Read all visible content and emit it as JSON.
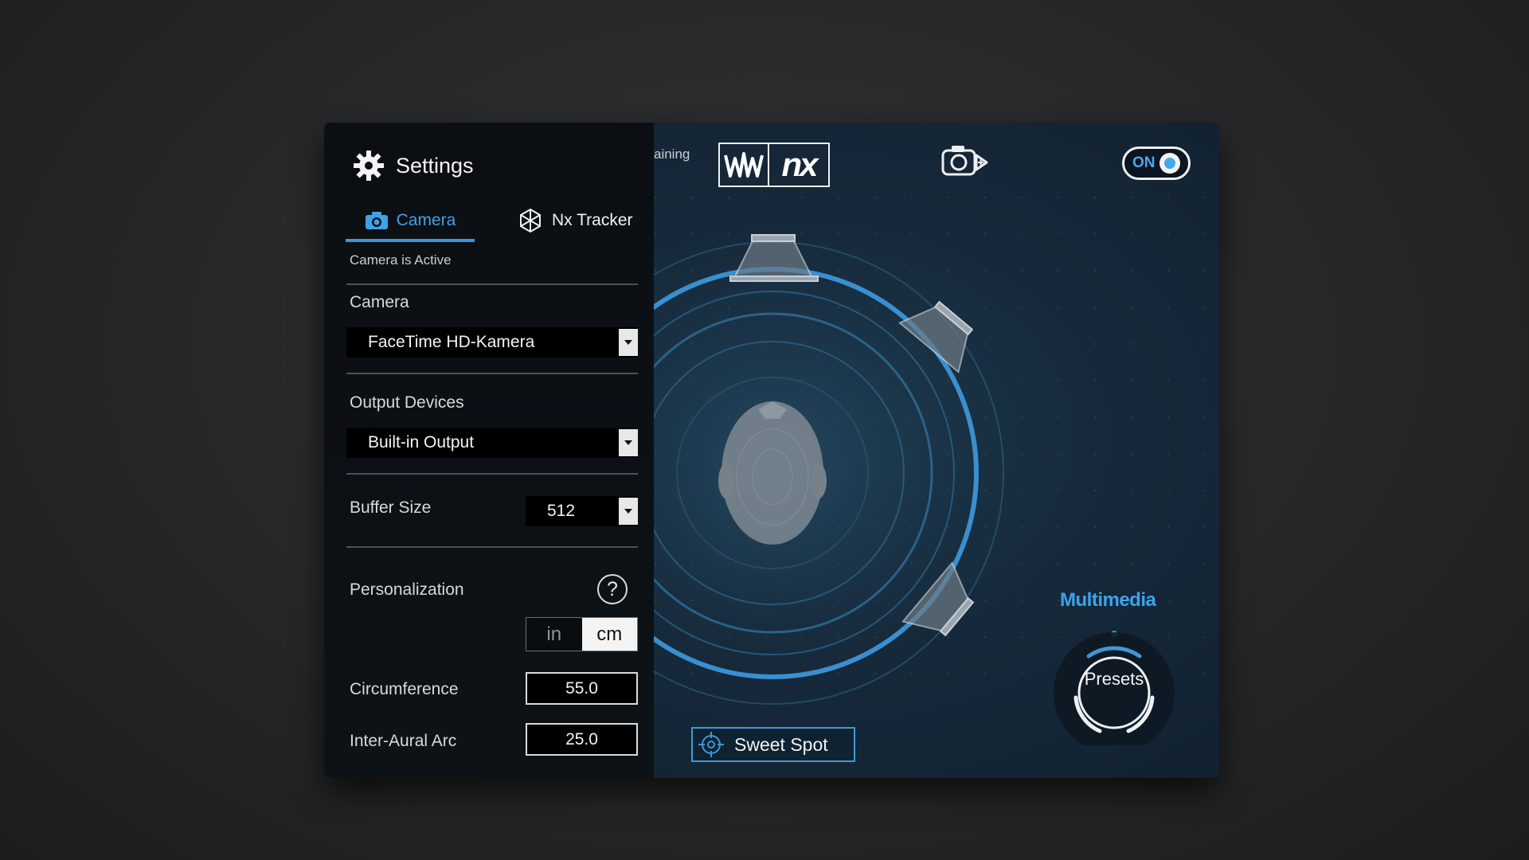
{
  "panel": {
    "title": "Settings",
    "title_icon": "gear-icon",
    "tabs": [
      {
        "label": "Camera",
        "icon": "camera-icon",
        "active": true
      },
      {
        "label": "Nx Tracker",
        "icon": "nx-tracker-icon",
        "active": false
      }
    ],
    "status": "Camera is Active",
    "camera": {
      "label": "Camera",
      "value": "FaceTime HD-Kamera"
    },
    "output": {
      "label": "Output Devices",
      "value": "Built-in Output"
    },
    "buffer": {
      "label": "Buffer Size",
      "value": "512"
    },
    "personalization": {
      "label": "Personalization",
      "help": "?",
      "units": [
        {
          "label": "in",
          "selected": false
        },
        {
          "label": "cm",
          "selected": true
        }
      ]
    },
    "circumference": {
      "label": "Circumference",
      "value": "55.0"
    },
    "inter_aural": {
      "label": "Inter-Aural Arc",
      "value": "25.0"
    }
  },
  "top": {
    "partial_text": "aining",
    "logo_text": "nx",
    "power": {
      "label": "ON",
      "state": "on"
    }
  },
  "stage": {
    "sweet_spot": "Sweet Spot",
    "preset_category": "Multimedia",
    "presets": "Presets"
  },
  "colors": {
    "accent": "#3e96d8",
    "panel_bg": "#0b0f14",
    "stage_bg": "#16293a"
  }
}
